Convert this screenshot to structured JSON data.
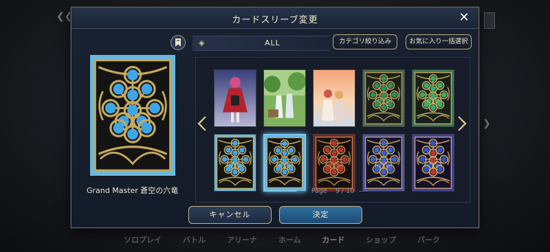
{
  "background": {
    "nav": [
      {
        "label": "ソロプレイ",
        "active": false
      },
      {
        "label": "バトル",
        "active": false
      },
      {
        "label": "アリーナ",
        "active": false
      },
      {
        "label": "ホーム",
        "active": false
      },
      {
        "label": "カード",
        "active": true
      },
      {
        "label": "ショップ",
        "active": false
      },
      {
        "label": "パーク",
        "active": false
      }
    ]
  },
  "modal": {
    "title": "カードスリーブ変更",
    "close_icon": "close-icon"
  },
  "preview": {
    "name": "Grand Master 蒼空の六竜",
    "style": "blue"
  },
  "filter": {
    "label": "ALL",
    "category_button": "カテゴリ絞り込み",
    "favorite_button": "お気に入り一括選択"
  },
  "sleeves": [
    {
      "kind": "art",
      "art": "char-red-dress",
      "selected": false
    },
    {
      "kind": "art",
      "art": "char-forest-group",
      "selected": false
    },
    {
      "kind": "art",
      "art": "char-sunset-pair",
      "selected": false
    },
    {
      "kind": "pattern",
      "style": "green-dark",
      "selected": false
    },
    {
      "kind": "pattern",
      "style": "green-bright",
      "selected": false
    },
    {
      "kind": "pattern",
      "style": "blue",
      "selected": false
    },
    {
      "kind": "pattern",
      "style": "blue",
      "selected": true
    },
    {
      "kind": "pattern",
      "style": "red",
      "selected": false
    },
    {
      "kind": "pattern",
      "style": "blue-purple",
      "selected": false
    },
    {
      "kind": "pattern",
      "style": "purple-red",
      "selected": false
    }
  ],
  "pagination": {
    "label": "Page",
    "current": "9",
    "separator": "/",
    "total": "10"
  },
  "buttons": {
    "cancel": "キャンセル",
    "confirm": "決定"
  },
  "colors": {
    "gold": "#c7b37a",
    "accent_blue": "#6cc3f5",
    "confirm_blue": "#2f6e9c"
  }
}
